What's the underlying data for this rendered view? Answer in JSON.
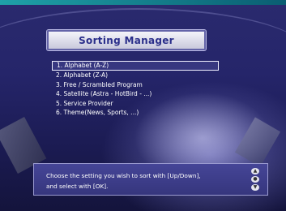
{
  "title": "Sorting Manager",
  "menu": {
    "items": [
      {
        "label": "1. Alphabet (A-Z)",
        "selected": true
      },
      {
        "label": "2. Alphabet (Z-A)",
        "selected": false
      },
      {
        "label": "3. Free / Scrambled Program",
        "selected": false
      },
      {
        "label": "4. Satellite (Astra - HotBird - ...)",
        "selected": false
      },
      {
        "label": "5. Service Provider",
        "selected": false
      },
      {
        "label": "6. Theme(News, Sports, ...)",
        "selected": false
      }
    ]
  },
  "help": {
    "line1": "Choose the setting you wish to sort with [Up/Down],",
    "line2": "and select with [OK]."
  },
  "icons": {
    "up": "arrow-up-icon",
    "ok": "ok-icon",
    "down": "arrow-down-icon"
  }
}
